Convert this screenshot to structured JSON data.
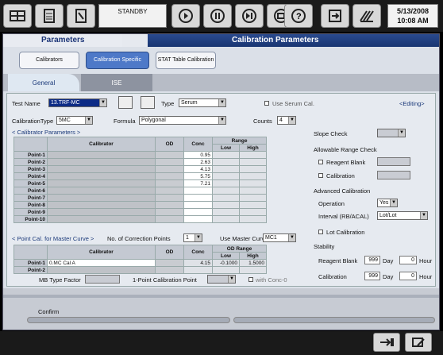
{
  "topbar": {
    "standby": "STANDBY",
    "date": "5/13/2008",
    "time": "10:08 AM"
  },
  "header": {
    "left": "Parameters",
    "right": "Calibration Parameters"
  },
  "tabs": [
    {
      "label": "Calibrators"
    },
    {
      "label": "Calibration Specific"
    },
    {
      "label": "STAT Table Calibration"
    }
  ],
  "subtabs": {
    "general": "General",
    "ise": "ISE"
  },
  "form": {
    "test_name_label": "Test Name",
    "test_name": "13.TRF-MC",
    "type_label": "Type",
    "type": "Serum",
    "use_serum_cal": "Use Serum Cal.",
    "editing": "<Editing>",
    "cal_type_label": "CalibrationType",
    "cal_type": "5MC",
    "formula_label": "Formula",
    "formula": "Polygonal",
    "counts_label": "Counts",
    "counts": "4",
    "cal_params": "< Calibrator Parameters >",
    "col_calibrator": "Calibrator",
    "col_od": "OD",
    "col_conc": "Conc",
    "col_range": "Range",
    "col_low": "Low",
    "col_high": "High",
    "points": [
      {
        "label": "Point-1",
        "conc": "0.95"
      },
      {
        "label": "Point-2",
        "conc": "2.63"
      },
      {
        "label": "Point-3",
        "conc": "4.13"
      },
      {
        "label": "Point-4",
        "conc": "5.75"
      },
      {
        "label": "Point-5",
        "conc": "7.21"
      },
      {
        "label": "Point-6",
        "conc": ""
      },
      {
        "label": "Point-7",
        "conc": ""
      },
      {
        "label": "Point-8",
        "conc": ""
      },
      {
        "label": "Point-9",
        "conc": ""
      },
      {
        "label": "Point-10",
        "conc": ""
      }
    ],
    "pcal_label": "< Point Cal. for Master Curve >",
    "ncp_label": "No. of Correction Points",
    "ncp": "1",
    "umc_label": "Use Master Curve",
    "umc": "MC1",
    "od_range": "OD Range",
    "mc_points": [
      {
        "label": "Point-1",
        "calibrator": "0.MC Cal A",
        "conc": "4.15",
        "low": "-0.1000",
        "high": "1.5000"
      },
      {
        "label": "Point-2",
        "calibrator": "",
        "conc": "",
        "low": "",
        "high": ""
      }
    ],
    "mb_label": "MB Type Factor",
    "ipcp_label": "1-Point Calibration Point",
    "with_conc": "with Conc-0",
    "slope_check": "Slope Check",
    "arc": "Allowable Range Check",
    "reagent_blank": "Reagent Blank",
    "calibration": "Calibration",
    "adv_cal": "Advanced Calibration",
    "operation_label": "Operation",
    "operation": "Yes",
    "interval_label": "Interval (RB/ACAL)",
    "interval": "Lot/Lot",
    "lot_cal": "Lot Calibration",
    "stability": "Stability",
    "rb_label": "Reagent Blank",
    "rb_day": "999",
    "cal_label": "Calibration",
    "cal_day": "999",
    "day": "Day",
    "hour": "Hour",
    "zero": "0"
  },
  "footer": {
    "confirm": "Confirm"
  },
  "icons": [
    "tray-icon",
    "list-icon",
    "report-icon",
    "play-icon",
    "pause-icon",
    "skip-icon",
    "stop-icon",
    "help-icon",
    "transfer-icon",
    "hatch-icon",
    "export-icon",
    "edit-icon"
  ]
}
